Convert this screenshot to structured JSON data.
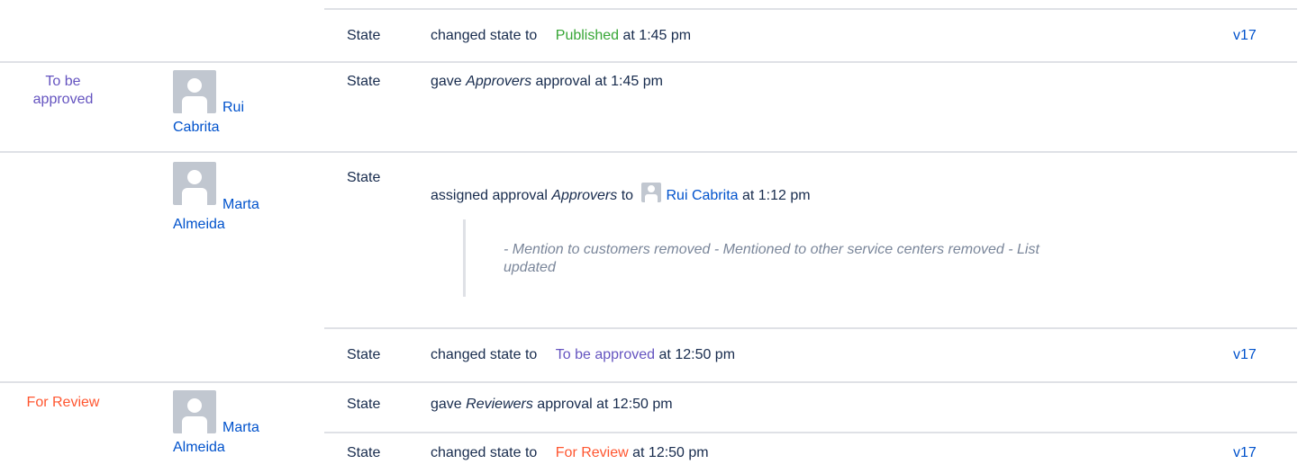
{
  "colors": {
    "published": "#36a635",
    "to_be_approved": "#6554c0",
    "for_review": "#ff5630",
    "link": "#0052cc"
  },
  "rows": [
    {
      "type": "State",
      "action_prefix": "changed state to",
      "state": "Published",
      "time": "at 1:45 pm",
      "version": "v17"
    },
    {
      "stage": "To be approved",
      "user": "Rui Cabrita",
      "type": "State",
      "action_prefix": "gave",
      "group": "Approvers",
      "action_suffix": "approval at 1:45 pm"
    },
    {
      "user": "Marta Almeida",
      "type": "State",
      "action_prefix": "assigned approval",
      "group": "Approvers",
      "to": "to",
      "assignee": "Rui Cabrita",
      "time": "at 1:12 pm",
      "comment": "- Mention to customers removed - Mentioned to other service centers removed - List updated"
    },
    {
      "type": "State",
      "action_prefix": "changed state to",
      "state": "To be approved",
      "time": "at 12:50 pm",
      "version": "v17"
    },
    {
      "stage": "For Review",
      "user": "Marta Almeida",
      "type": "State",
      "action_prefix": "gave",
      "group": "Reviewers",
      "action_suffix": "approval at 12:50 pm"
    },
    {
      "type": "State",
      "action_prefix": "changed state to",
      "state": "For Review",
      "time": "at 12:50 pm",
      "version": "v17"
    }
  ]
}
